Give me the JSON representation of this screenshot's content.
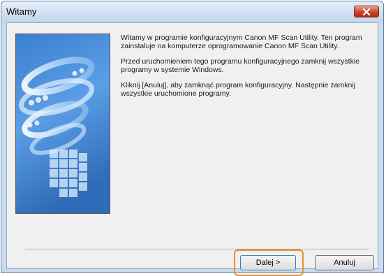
{
  "window": {
    "title": "Witamy",
    "close_icon": "close-icon"
  },
  "content": {
    "paragraphs": [
      "Witamy w programie konfiguracyjnym Canon MF Scan Utility. Ten program zainstaluje na komputerze oprogramowanie Canon MF Scan Utility.",
      "Przed uruchomieniem tego programu konfiguracyjnego zamknij wszystkie programy w systemie Windows.",
      "Kliknij [Anuluj], aby zamknąć program konfiguracyjny. Następnie zamknij wszystkie uruchomione programy."
    ]
  },
  "buttons": {
    "next_label": "Dalej >",
    "cancel_label": "Anuluj"
  },
  "colors": {
    "highlight": "#e6932a",
    "close_button": "#cf4a31"
  }
}
